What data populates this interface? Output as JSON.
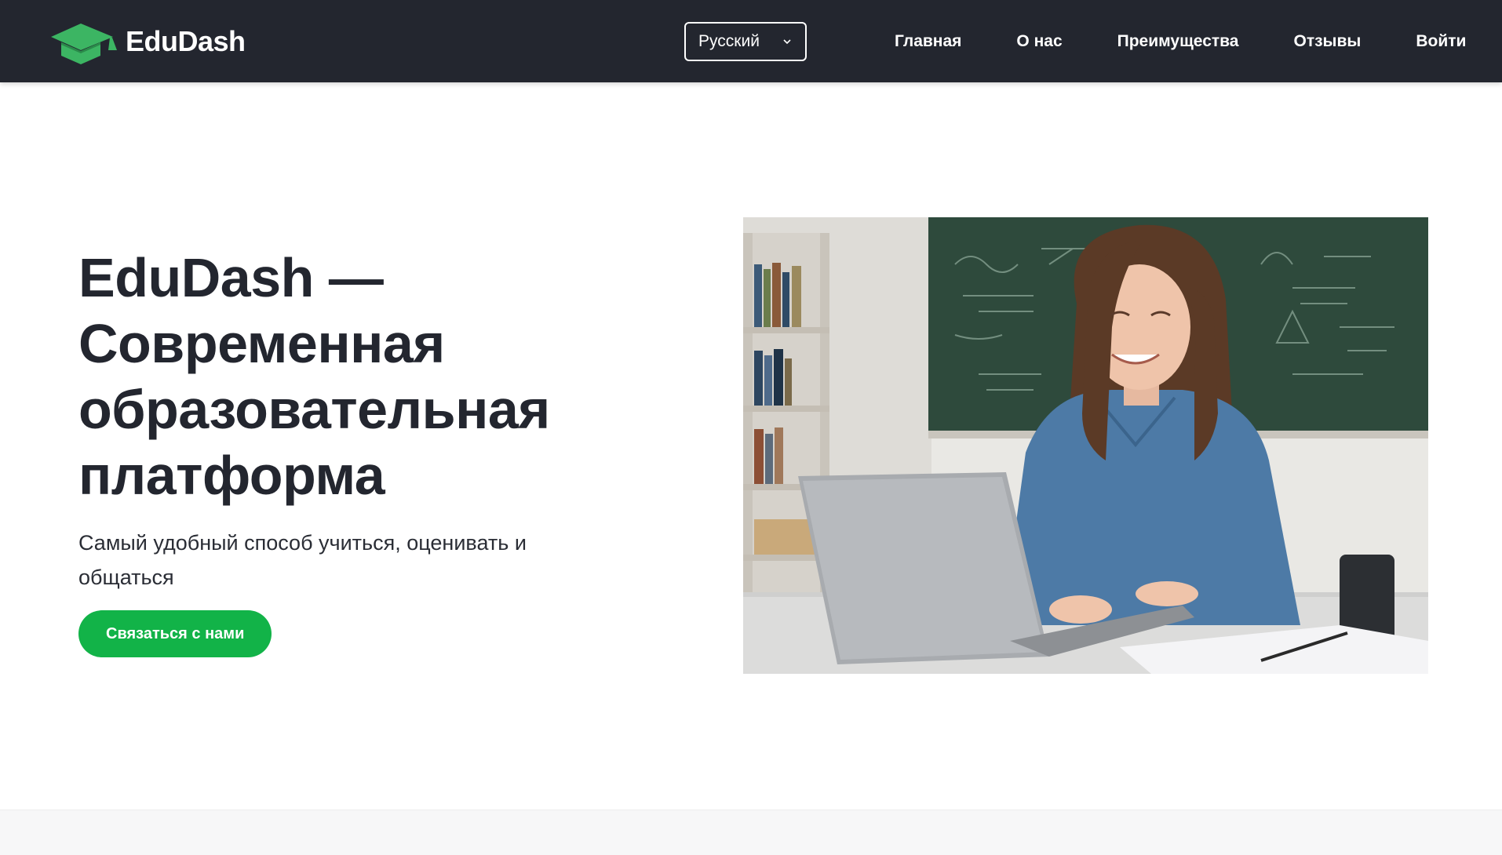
{
  "brand": {
    "name": "EduDash",
    "icon": "graduation-cap-icon",
    "accent_color": "#3cb563"
  },
  "header": {
    "background": "#23262f",
    "language_select": {
      "selected": "Русский",
      "icon": "chevron-down-icon"
    },
    "nav": [
      {
        "label": "Главная"
      },
      {
        "label": "О нас"
      },
      {
        "label": "Преимущества"
      },
      {
        "label": "Отзывы"
      },
      {
        "label": "Войти"
      }
    ]
  },
  "hero": {
    "title_lines": [
      "EduDash —",
      "Современная",
      "образовательная",
      "платформа"
    ],
    "subtitle": "Самый удобный способ учиться, оценивать и общаться",
    "cta_label": "Связаться с нами",
    "cta_color": "#12b348",
    "image_description": "Smiling student in a denim shirt working on a laptop in a classroom with a chalkboard"
  }
}
